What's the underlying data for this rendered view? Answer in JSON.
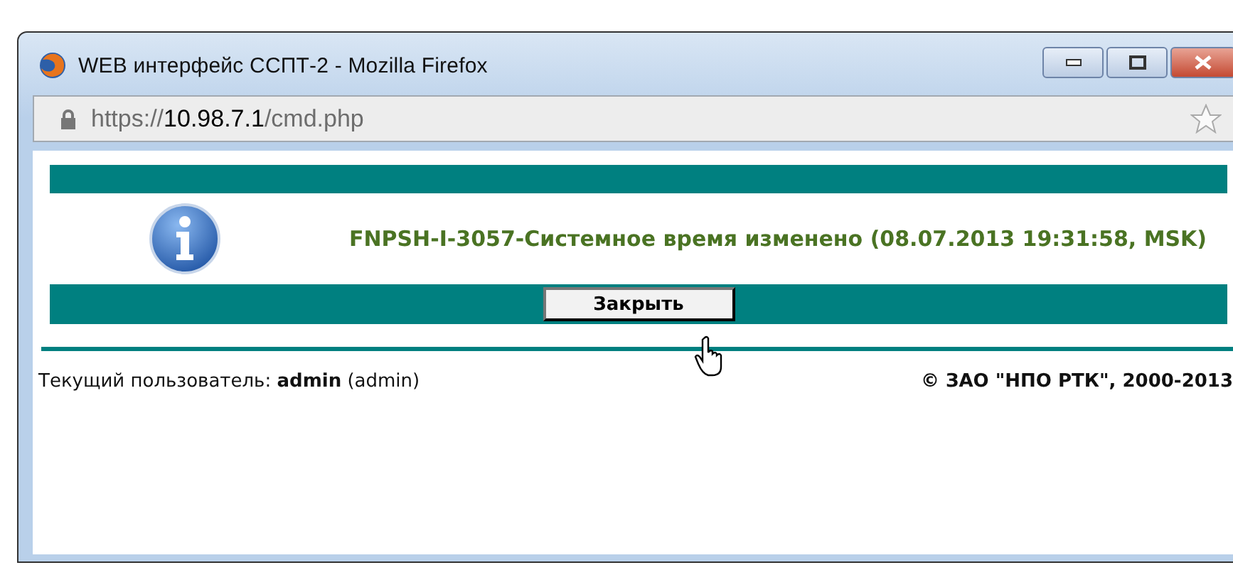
{
  "window": {
    "title": "WEB интерфейс ССПТ-2 - Mozilla Firefox"
  },
  "address_bar": {
    "scheme": "https://",
    "host": "10.98.7.1",
    "path": "/cmd.php",
    "bookmarked": false
  },
  "message": {
    "kind": "info",
    "text": "FNPSH-I-3057-Системное время изменено (08.07.2013 19:31:58, MSK)"
  },
  "buttons": [
    "Закрыть"
  ],
  "footer": {
    "user": "Текущий пользователь: **admin** (admin)",
    "copyright": "© ЗАО \"НПО РТК\", 2000-2013"
  }
}
